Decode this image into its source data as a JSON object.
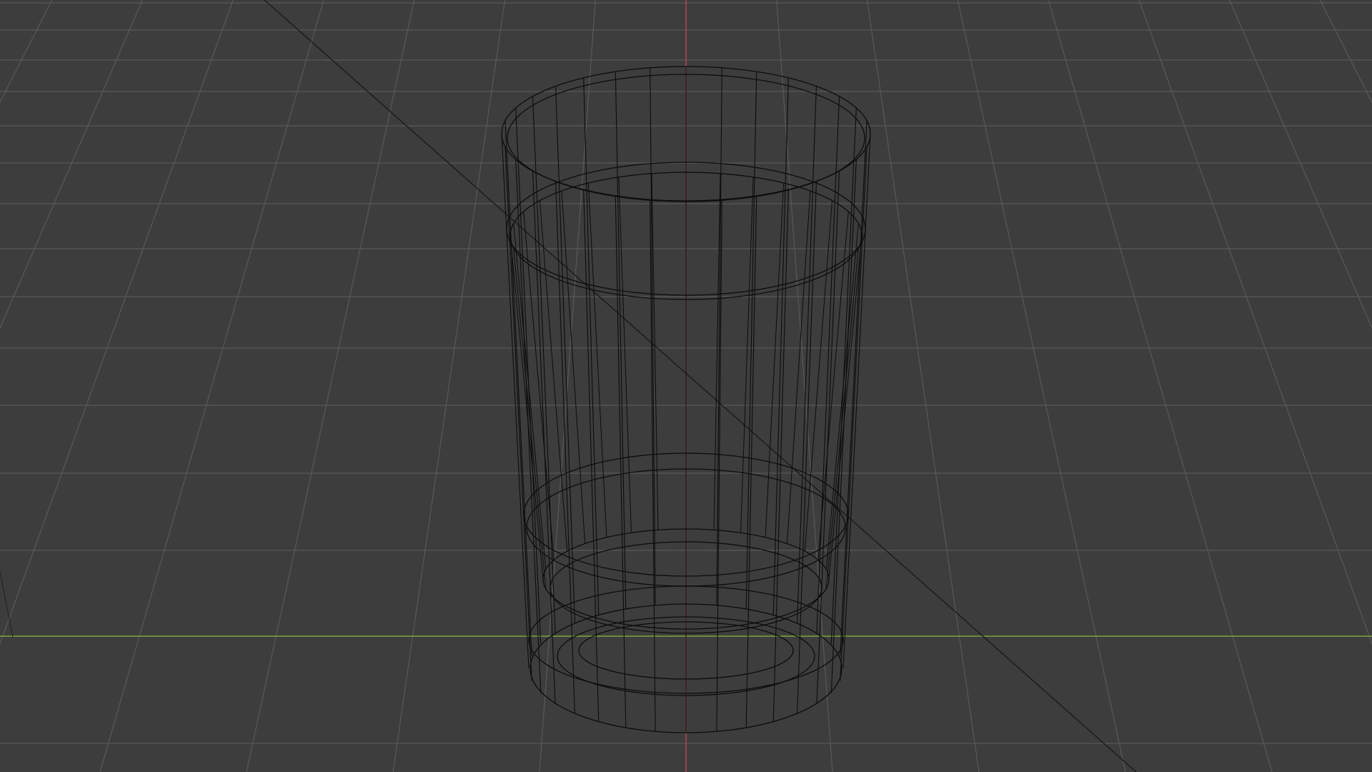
{
  "viewport": {
    "mode": "wireframe",
    "background_color": "#3d3d3d",
    "grid_color": "#595959",
    "x_axis_color": "#a94552",
    "y_axis_color": "#7aa43a",
    "wire_color": "#0c0c0c"
  },
  "object": {
    "type": "glass-cup-mesh",
    "vertical_edge_count": 32
  }
}
